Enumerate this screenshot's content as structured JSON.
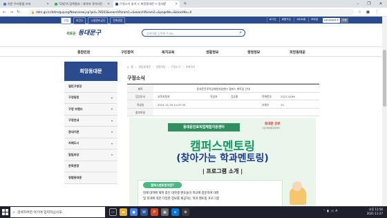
{
  "browser": {
    "tabs": [
      {
        "title": "쉬운 우리말을 쓰자",
        "active": false,
        "fav_color": "#4a7be8"
      },
      {
        "title": "'모범'의 검색결과 : 네이버 국어사전",
        "active": false,
        "fav_color": "#19c94a"
      },
      {
        "title": "구정소식 읽기 < 희망동대문 < 동대문",
        "active": true,
        "fav_color": "#2a4b8d"
      }
    ],
    "url": "ddm.go.kr/ddm/gujung/Newsview.jsp?pid=78503&searchParam1=&searchParam2=&pageNo=&blockNo=0",
    "new_tab": "+"
  },
  "site": {
    "top_buttons": [
      "구청",
      "보건소",
      "시설관리공단",
      "문화관광"
    ],
    "top_links": [
      "로그인",
      "회원가입",
      "사이트맵",
      "모바일"
    ],
    "language": "Language",
    "lang_go": "이동",
    "logo_small": "새로운",
    "logo_main": "동대문구",
    "search_placeholder": "검색어를 입력해 주세요",
    "gnb": [
      "종합민원",
      "구민참여",
      "복지교육",
      "생활정보",
      "행정정보",
      "희망동대문"
    ]
  },
  "sidebar": {
    "title": "희망동대문",
    "items": [
      {
        "label": "열린구청장",
        "arrow": ""
      },
      {
        "label": "구정동정",
        "arrow": "▾"
      },
      {
        "label": "구정 브랜드",
        "arrow": "▾"
      },
      {
        "label": "구정안내",
        "arrow": "▾"
      },
      {
        "label": "관내기관",
        "arrow": "▾"
      },
      {
        "label": "자매도시",
        "arrow": "▾"
      },
      {
        "label": "알림마당",
        "arrow": "▾"
      },
      {
        "label": "문화관광",
        "arrow": ""
      },
      {
        "label": "청렴동대문",
        "arrow": ""
      }
    ]
  },
  "content": {
    "breadcrumb": [
      "홈",
      "희망동대문",
      "알림마당",
      "구정소식",
      "조회하기"
    ],
    "title": "구정소식",
    "table": {
      "subject_label": "제목",
      "subject": "동대문진로직업체험지원센터 캠퍼스 멘토링 안내",
      "dept_label": "담당부서",
      "dept": "교육지원과",
      "writer_label": "작성자",
      "writer": "김승휘",
      "phone_label": "전화번호",
      "phone": "2127-5199",
      "date_label": "작성일",
      "date": "2021-11-19 11:07:35",
      "views_label": "조회수",
      "views": "70",
      "attach_label": "첨부파일"
    }
  },
  "poster": {
    "band": "동대문진로직업체험지원센터",
    "stamp": "동대문 진로",
    "stamp_sub": "진로직업체험지원센터",
    "headline": "캠퍼스멘토링",
    "subheadline": "(찾아가는 학과멘토링)",
    "program": "| 프로그램 소개 |",
    "pill": "캠퍼스멘토링이란?",
    "line1": "현재 대학에 재학 중인 대학생 멘토들이 학교에 방문하여 대학",
    "line2": "및 학과에 대한 다양한 정보를 제공하는 학과 멘토링 프로그램"
  },
  "taskbar": {
    "search_placeholder": "검색하려면 여기에 입력하십시오.",
    "time": "오후 11:56",
    "date": "2021-11-27",
    "lang_indicator": "A"
  }
}
